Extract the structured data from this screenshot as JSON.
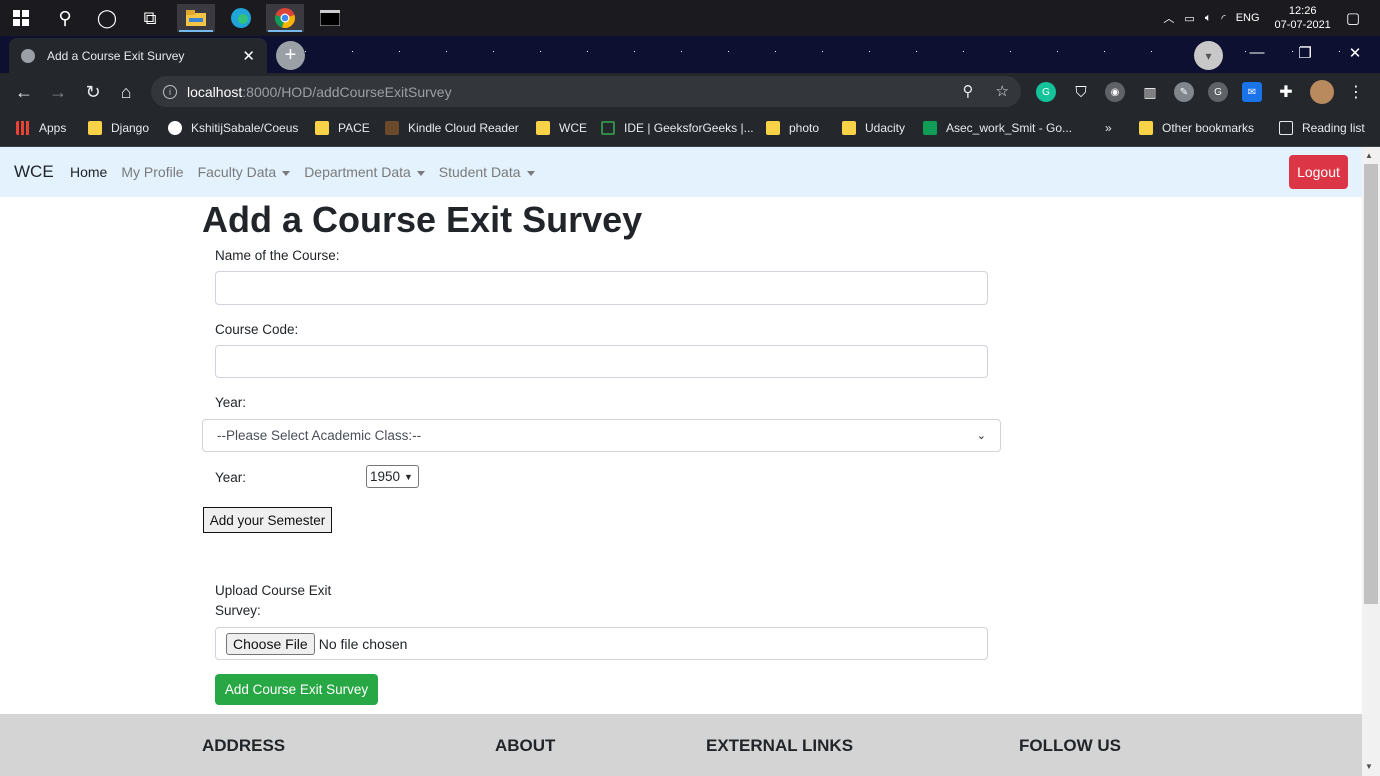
{
  "taskbar": {
    "tray": {
      "lang": "ENG",
      "time": "12:26",
      "date": "07-07-2021"
    }
  },
  "browser": {
    "tab_title": "Add a Course Exit Survey",
    "url_host": "localhost",
    "url_path": ":8000/HOD/addCourseExitSurvey",
    "bookmarks": [
      {
        "label": "Apps"
      },
      {
        "label": "Django"
      },
      {
        "label": "KshitijSabale/Coeus"
      },
      {
        "label": "PACE"
      },
      {
        "label": "Kindle Cloud Reader"
      },
      {
        "label": "WCE"
      },
      {
        "label": "IDE | GeeksforGeeks |..."
      },
      {
        "label": "photo"
      },
      {
        "label": "Udacity"
      },
      {
        "label": "Asec_work_Smit - Go..."
      },
      {
        "label": "Other bookmarks"
      },
      {
        "label": "Reading list"
      }
    ]
  },
  "navbar": {
    "brand": "WCE",
    "links": [
      "Home",
      "My Profile",
      "Faculty Data",
      "Department Data",
      "Student Data"
    ],
    "logout": "Logout"
  },
  "form": {
    "title": "Add a Course Exit Survey",
    "course_name_label": "Name of the Course:",
    "course_code_label": "Course Code:",
    "year_label": "Year:",
    "class_select": "--Please Select Academic Class:--",
    "year2_label": "Year:",
    "year_value": "1950",
    "semester_button": "Add your Semester",
    "upload_label_1": "Upload Course Exit",
    "upload_label_2": "Survey:",
    "choose_file": "Choose File",
    "no_file": "No file chosen",
    "submit": "Add Course Exit Survey"
  },
  "footer": {
    "headings": [
      "ADDRESS",
      "ABOUT",
      "EXTERNAL LINKS",
      "FOLLOW US"
    ]
  },
  "colors": {
    "navbar_bg": "#e3f2fd",
    "logout": "#dc3545",
    "submit": "#28a745",
    "footer_bg": "#d4d4d4"
  }
}
